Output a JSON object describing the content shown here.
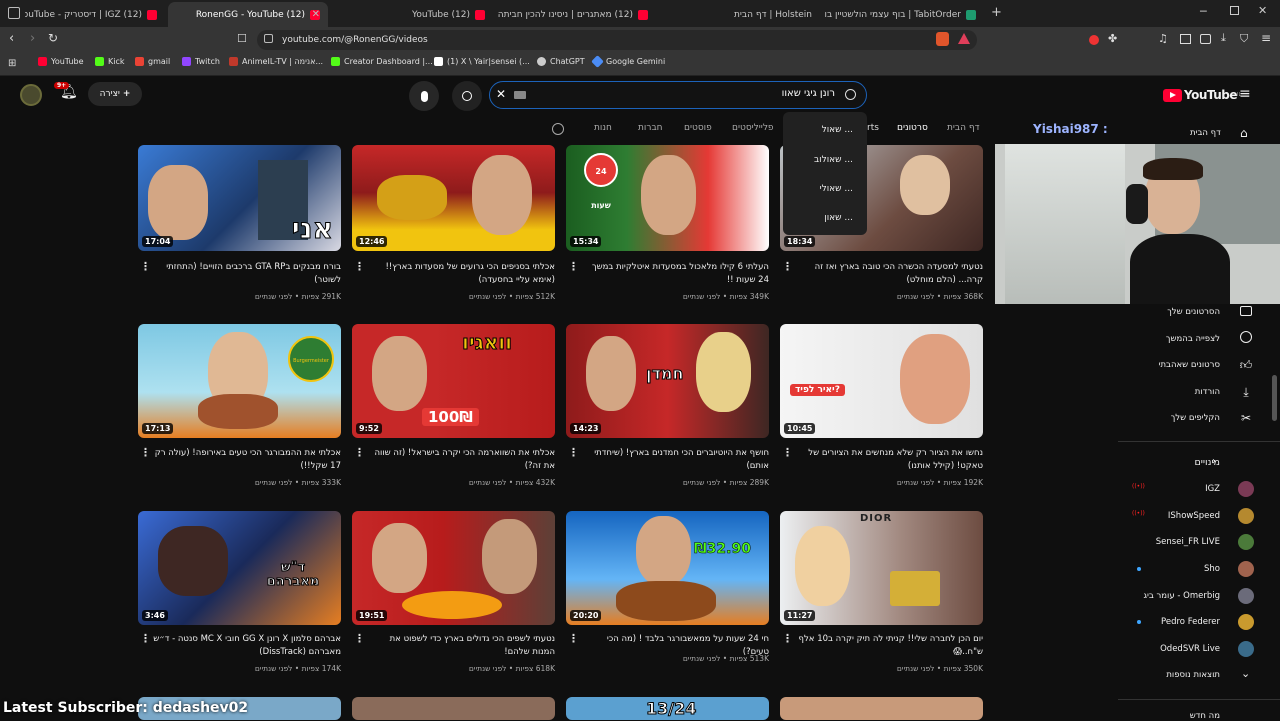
{
  "browser": {
    "tabs": [
      {
        "label": "(12) IGZ | דיסטריק - YouTube",
        "color": "#ff0033"
      },
      {
        "label": "(12) RonenGG - YouTube",
        "color": "#ff0033"
      },
      {
        "label": "(12) YouTube",
        "color": "#ff0033"
      },
      {
        "label": "(12) מאתגרים | ניסינו להכין חביתה עם...",
        "color": "#ff0033"
      },
      {
        "label": "Holstein | דף הבית",
        "color": "#888888"
      },
      {
        "label": "TabitOrder | בוף עצמי הולשטיין בורגר",
        "color": "#1e9b6f"
      }
    ],
    "url": "youtube.com/@RonenGG/videos",
    "bookmarks": [
      {
        "label": "YouTube",
        "color": "#ff0033"
      },
      {
        "label": "Kick",
        "color": "#53fc18"
      },
      {
        "label": "gmail",
        "color": "#ea4335"
      },
      {
        "label": "Twitch",
        "color": "#9146ff"
      },
      {
        "label": "AnimeIL-TV | אנימה...",
        "color": "#c0392b"
      },
      {
        "label": "Creator Dashboard |...",
        "color": "#53fc18"
      },
      {
        "label": "(1) X \\ Yair|sensei (...",
        "color": "#ffffff"
      },
      {
        "label": "ChatGPT",
        "color": "#cccccc"
      },
      {
        "label": "Google Gemini",
        "color": "#4b8cf5"
      }
    ]
  },
  "header": {
    "logo": "YouTube",
    "logo_sup": "IL",
    "create_label": "יצירה",
    "notif_count": "9+",
    "search_value": "רונן גיגי שאוו"
  },
  "channel_nav": {
    "items": [
      "דף הבית",
      "סרטונים",
      "rts",
      "פלייליסטים",
      "פוסטים",
      "חברות",
      "חנות"
    ],
    "user_label": "Yishai987 :"
  },
  "suggestions": [
    "... שאול",
    "... שאולוב",
    "... שאולי",
    "... שאון"
  ],
  "videos": [
    {
      "title": "בורח מבנקים בGTA RP ברכבים הזויים! (התחזתי לשוטר)",
      "meta": "291K צפיות • לפני שנתיים",
      "dur": "17:04"
    },
    {
      "title": "אכלתי בסניפים הכי גרועים של מסעדות בארץ!! (אימא עליי בחסעדה)",
      "meta": "512K צפיות • לפני שנתיים",
      "dur": "12:46"
    },
    {
      "title": "העלתי 6 קילו מלאכול במסעדות איטלקיות במשך 24 שעות !!",
      "meta": "349K צפיות • לפני שנתיים",
      "dur": "15:34"
    },
    {
      "title": "נטעתי למסעדה הכשרה הכי טובה בארץ ואז זה קרה... (הלם מוחלט)",
      "meta": "368K צפיות • לפני שנתיים",
      "dur": "18:34"
    },
    {
      "title": "אכלתי את ההמבורגר הכי טעים באירופה! (עולה רק 17 שקל!!)",
      "meta": "333K צפיות • לפני שנתיים",
      "dur": "17:13"
    },
    {
      "title": "אכלתי את השווארמה הכי יקרה בישראל! (זה שווה את זה?)",
      "meta": "432K צפיות • לפני שנתיים",
      "dur": "9:52"
    },
    {
      "title": "חושף את היוטיוברים הכי חמדנים בארץ! (שיחדתי אותם)",
      "meta": "289K צפיות • לפני שנתיים",
      "dur": "14:23"
    },
    {
      "title": "נחשו את הציור רק שלא מנחשים את הציורים של טאקט! (קילל אותנו)",
      "meta": "192K צפיות • לפני שנתיים",
      "dur": "10:45"
    },
    {
      "title": "אברהם סלמון X רונן GG X חובי MC X סנטה - ד״ש מאברהם (DissTrack)",
      "meta": "174K צפיות • לפני שנתיים",
      "dur": "3:46"
    },
    {
      "title": "נטעתי לשפים הכי גדולים בארץ כדי לשפוט את המנות שלהם!",
      "meta": "618K צפיות • לפני שנתיים",
      "dur": "19:51"
    },
    {
      "title": "חי 24 שעות על ממאשבורגר בלבד ! (מה הכי טעים?)",
      "meta": "513K צפיות • לפני שנתיים",
      "dur": "20:20"
    },
    {
      "title": "יום הכן לחברה שלי!! קניתי לה תיק יקרה ב10 אלף ש\"ח..😱",
      "meta": "350K צפיות • לפני שנתיים",
      "dur": "11:27"
    }
  ],
  "thumb_labels": {
    "t1": "אני",
    "t3": "24 שעות",
    "t5": "Burgermeister",
    "t6": "וואגיו",
    "t6b": "100₪",
    "t7": "חמדן",
    "t8": "יאיר לפיד?",
    "t9": "ד\"ש מאברהם",
    "t11": "₪32.90",
    "t12": "DIOR",
    "t15": "13/24"
  },
  "sidebar": {
    "items": [
      "הסרטונים שלך",
      "לצפייה בהמשך",
      "סרטונים שאהבתי",
      "הורדות",
      "הקליפים שלך"
    ],
    "subs_header": "מינויים",
    "subs": [
      {
        "name": "IGZ",
        "live": true,
        "color": "#7a3a55"
      },
      {
        "name": "IShowSpeed",
        "live": true,
        "color": "#b5892f"
      },
      {
        "name": "Sensei_FR LIVE",
        "live": false,
        "color": "#4b7a3a"
      },
      {
        "name": "Sho",
        "live": false,
        "color": "#a0634e"
      },
      {
        "name": "Omerbig - עומר ביג",
        "live": false,
        "color": "#6b6b7a"
      },
      {
        "name": "Pedro Federer",
        "live": false,
        "color": "#c99a2e"
      },
      {
        "name": "OdedSVR Live",
        "live": false,
        "color": "#3a6b8a"
      }
    ],
    "more": "תוצאות נוספות",
    "footer": "מה חדש"
  },
  "overlay": {
    "subscriber": "Latest Subscriber: dedashev02"
  },
  "colors": {
    "accent": "#ff0033",
    "search_border": "#1c62b9",
    "bg": "#0f0f0f"
  }
}
